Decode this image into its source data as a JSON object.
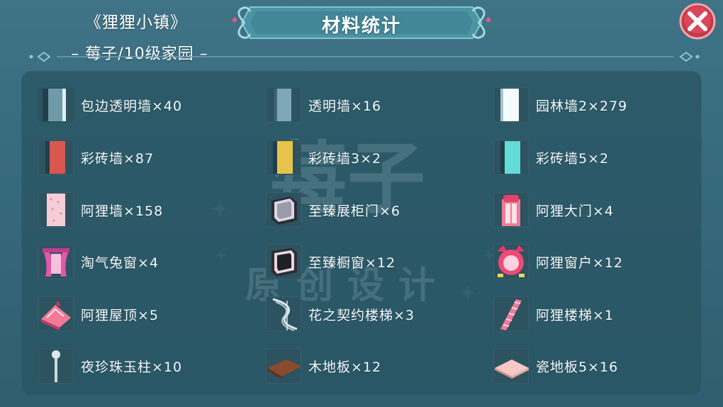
{
  "header": {
    "town_title": "《狸狸小镇》",
    "town_subtitle": "– 莓子/10级家园 –",
    "banner_title": "材料统计",
    "close_icon": "close-x-icon"
  },
  "watermark": {
    "text_top": "莓子",
    "text_bottom": "原创设计"
  },
  "items": [
    {
      "label": "包边透明墙×40",
      "icon": "edged-glass-wall-icon"
    },
    {
      "label": "透明墙×16",
      "icon": "glass-wall-icon"
    },
    {
      "label": "园林墙2×279",
      "icon": "garden-wall-icon"
    },
    {
      "label": "彩砖墙×87",
      "icon": "red-brick-wall-icon"
    },
    {
      "label": "彩砖墙3×2",
      "icon": "yellow-brick-wall-icon"
    },
    {
      "label": "彩砖墙5×2",
      "icon": "cyan-brick-wall-icon"
    },
    {
      "label": "阿狸墙×158",
      "icon": "ali-wall-icon"
    },
    {
      "label": "至臻展柜门×6",
      "icon": "display-cabinet-door-icon"
    },
    {
      "label": "阿狸大门×4",
      "icon": "ali-gate-icon"
    },
    {
      "label": "淘气兔窗×4",
      "icon": "bunny-window-icon"
    },
    {
      "label": "至臻橱窗×12",
      "icon": "showcase-window-icon"
    },
    {
      "label": "阿狸窗户×12",
      "icon": "ali-window-icon"
    },
    {
      "label": "阿狸屋顶×5",
      "icon": "ali-roof-icon"
    },
    {
      "label": "花之契约楼梯×3",
      "icon": "spiral-stairs-icon"
    },
    {
      "label": "阿狸楼梯×1",
      "icon": "ali-stairs-icon"
    },
    {
      "label": "夜珍珠玉柱×10",
      "icon": "pearl-pillar-icon"
    },
    {
      "label": "木地板×12",
      "icon": "wood-floor-icon"
    },
    {
      "label": "瓷地板5×16",
      "icon": "tile-floor-icon"
    }
  ]
}
